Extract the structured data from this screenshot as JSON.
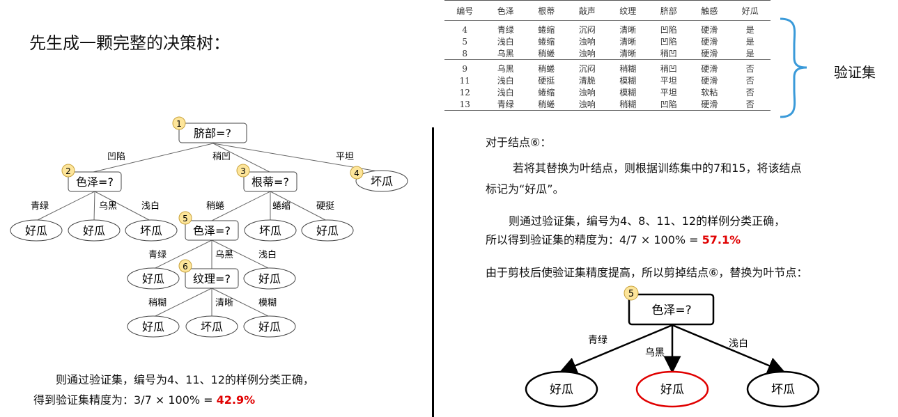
{
  "title": "先生成一颗完整的决策树：",
  "tree": {
    "root": {
      "label": "脐部=?",
      "num": "1"
    },
    "root_branches": [
      "凹陷",
      "稍凹",
      "平坦"
    ],
    "n2": {
      "label": "色泽=?",
      "num": "2"
    },
    "n3": {
      "label": "根蒂=?",
      "num": "3"
    },
    "n4": {
      "label": "坏瓜",
      "num": "4"
    },
    "n2_branches": [
      "青绿",
      "乌黑",
      "浅白"
    ],
    "n2_leaves": [
      "好瓜",
      "好瓜",
      "坏瓜"
    ],
    "n3_branches": [
      "稍蜷",
      "蜷缩",
      "硬挺"
    ],
    "n5": {
      "label": "色泽=?",
      "num": "5"
    },
    "n3_leaves": [
      "坏瓜",
      "好瓜"
    ],
    "n5_branches": [
      "青绿",
      "乌黑",
      "浅白"
    ],
    "n5_leaves": [
      "好瓜",
      "好瓜"
    ],
    "n6": {
      "label": "纹理=?",
      "num": "6"
    },
    "n6_branches": [
      "稍糊",
      "清晰",
      "模糊"
    ],
    "n6_leaves": [
      "好瓜",
      "坏瓜",
      "好瓜"
    ]
  },
  "left_result": {
    "line1": "则通过验证集，编号为4、11、12的样例分类正确，",
    "line2_prefix": "得到验证集精度为：3/7 × 100% = ",
    "line2_value": "42.9%"
  },
  "validation_table": {
    "headers": [
      "编号",
      "色泽",
      "根蒂",
      "敲声",
      "纹理",
      "脐部",
      "触感",
      "好瓜"
    ],
    "group1": [
      [
        "4",
        "青绿",
        "蜷缩",
        "沉闷",
        "清晰",
        "凹陷",
        "硬滑",
        "是"
      ],
      [
        "5",
        "浅白",
        "蜷缩",
        "浊响",
        "清晰",
        "凹陷",
        "硬滑",
        "是"
      ],
      [
        "8",
        "乌黑",
        "稍蜷",
        "浊响",
        "清晰",
        "稍凹",
        "硬滑",
        "是"
      ]
    ],
    "group2": [
      [
        "9",
        "乌黑",
        "稍蜷",
        "沉闷",
        "稍糊",
        "稍凹",
        "硬滑",
        "否"
      ],
      [
        "11",
        "浅白",
        "硬挺",
        "清脆",
        "模糊",
        "平坦",
        "硬滑",
        "否"
      ],
      [
        "12",
        "浅白",
        "蜷缩",
        "浊响",
        "模糊",
        "平坦",
        "软粘",
        "否"
      ],
      [
        "13",
        "青绿",
        "稍蜷",
        "浊响",
        "稍糊",
        "凹陷",
        "硬滑",
        "否"
      ]
    ],
    "label": "验证集",
    "brace_color": "#3a9ad9"
  },
  "right_text": {
    "node_title": "对于结点⑥：",
    "p1_line1": "若将其替换为叶结点，则根据训练集中的7和15，将该结点",
    "p1_line2": "标记为“好瓜”。",
    "p2_line1": "则通过验证集，编号为4、8、11、12的样例分类正确，",
    "p2_line2_prefix": "所以得到验证集的精度为：4/7 × 100% = ",
    "p2_line2_value": "57.1%",
    "p3": "由于剪枝后使验证集精度提高，所以剪掉结点⑥，替换为叶节点："
  },
  "pruned_tree": {
    "root": {
      "label": "色泽=?",
      "num": "5"
    },
    "branches": [
      "青绿",
      "乌黑",
      "浅白"
    ],
    "leaves": [
      "好瓜",
      "好瓜",
      "坏瓜"
    ],
    "highlight_color": "#e00000"
  },
  "colors": {
    "badge_fill": "#fde59a",
    "badge_stroke": "#c8a23c",
    "highlight_red": "#e00000"
  }
}
